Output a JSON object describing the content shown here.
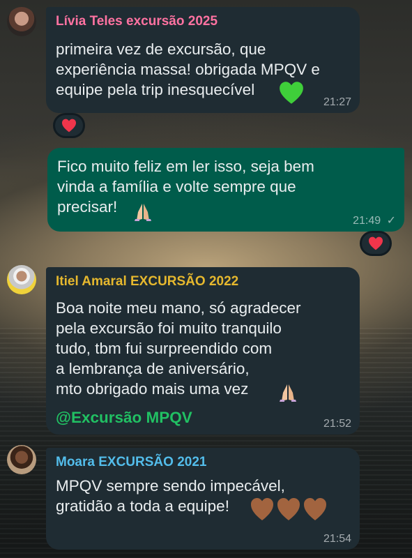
{
  "messages": [
    {
      "sender": "Lívia Teles excursão 2025",
      "sender_color": "#ff72a1",
      "text": "primeira vez de excursão, que\nexperiência massa! obrigada MPQV e\nequipe pela trip inesquecível",
      "emoji": "green-heart",
      "time": "21:27",
      "reaction": "red-heart"
    },
    {
      "sender": "",
      "text": "Fico muito feliz em ler isso, seja bem\nvinda a família e volte sempre que\nprecisar!",
      "emoji": "folded-hands",
      "time": "21:49",
      "status": "sent-check",
      "reaction": "red-heart"
    },
    {
      "sender": "Itiel Amaral EXCURSÃO 2022",
      "sender_color": "#e6b82e",
      "text": "Boa noite meu mano, só agradecer\npela excursão foi muito tranquilo\ntudo, tbm fui surpreendido com\na lembrança de aniversário,\nmto obrigado mais uma vez",
      "emoji": "folded-hands",
      "mention": "@Excursão MPQV",
      "mention_color": "#21c063",
      "time": "21:52"
    },
    {
      "sender": "Moara EXCURSÃO 2021",
      "sender_color": "#53bdeb",
      "text": "MPQV sempre sendo impecável,\ngratidão a toda a equipe!",
      "emoji": "brown-heart x3",
      "time": "21:54"
    }
  ]
}
